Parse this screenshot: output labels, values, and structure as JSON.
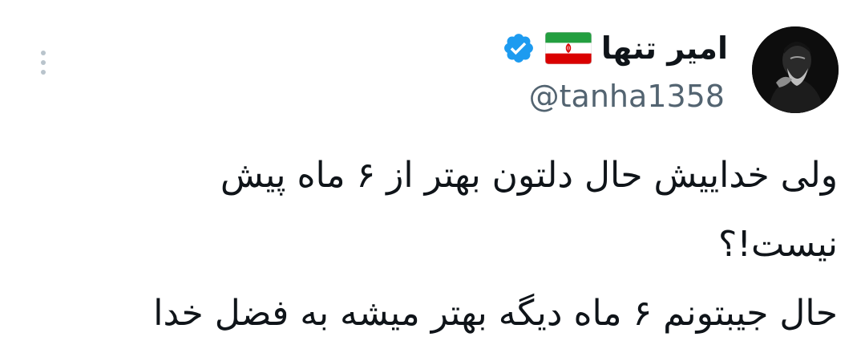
{
  "author": {
    "display_name": "امیر تنها",
    "handle": "@tanha1358",
    "flag_icon": "iran-flag-icon",
    "verified_icon": "verified-badge-icon",
    "verified_color": "#1d9bf0"
  },
  "menu": {
    "icon": "more-options-icon"
  },
  "tweet": {
    "lines": [
      "ولی خداییش حال دلتون بهتر از ۶ ماه پیش",
      "نیست!؟",
      "حال جیبتونم ۶ ماه دیگه بهتر میشه به فضل خدا"
    ]
  },
  "colors": {
    "text": "#0f1419",
    "handle": "#536471",
    "background": "#ffffff"
  }
}
